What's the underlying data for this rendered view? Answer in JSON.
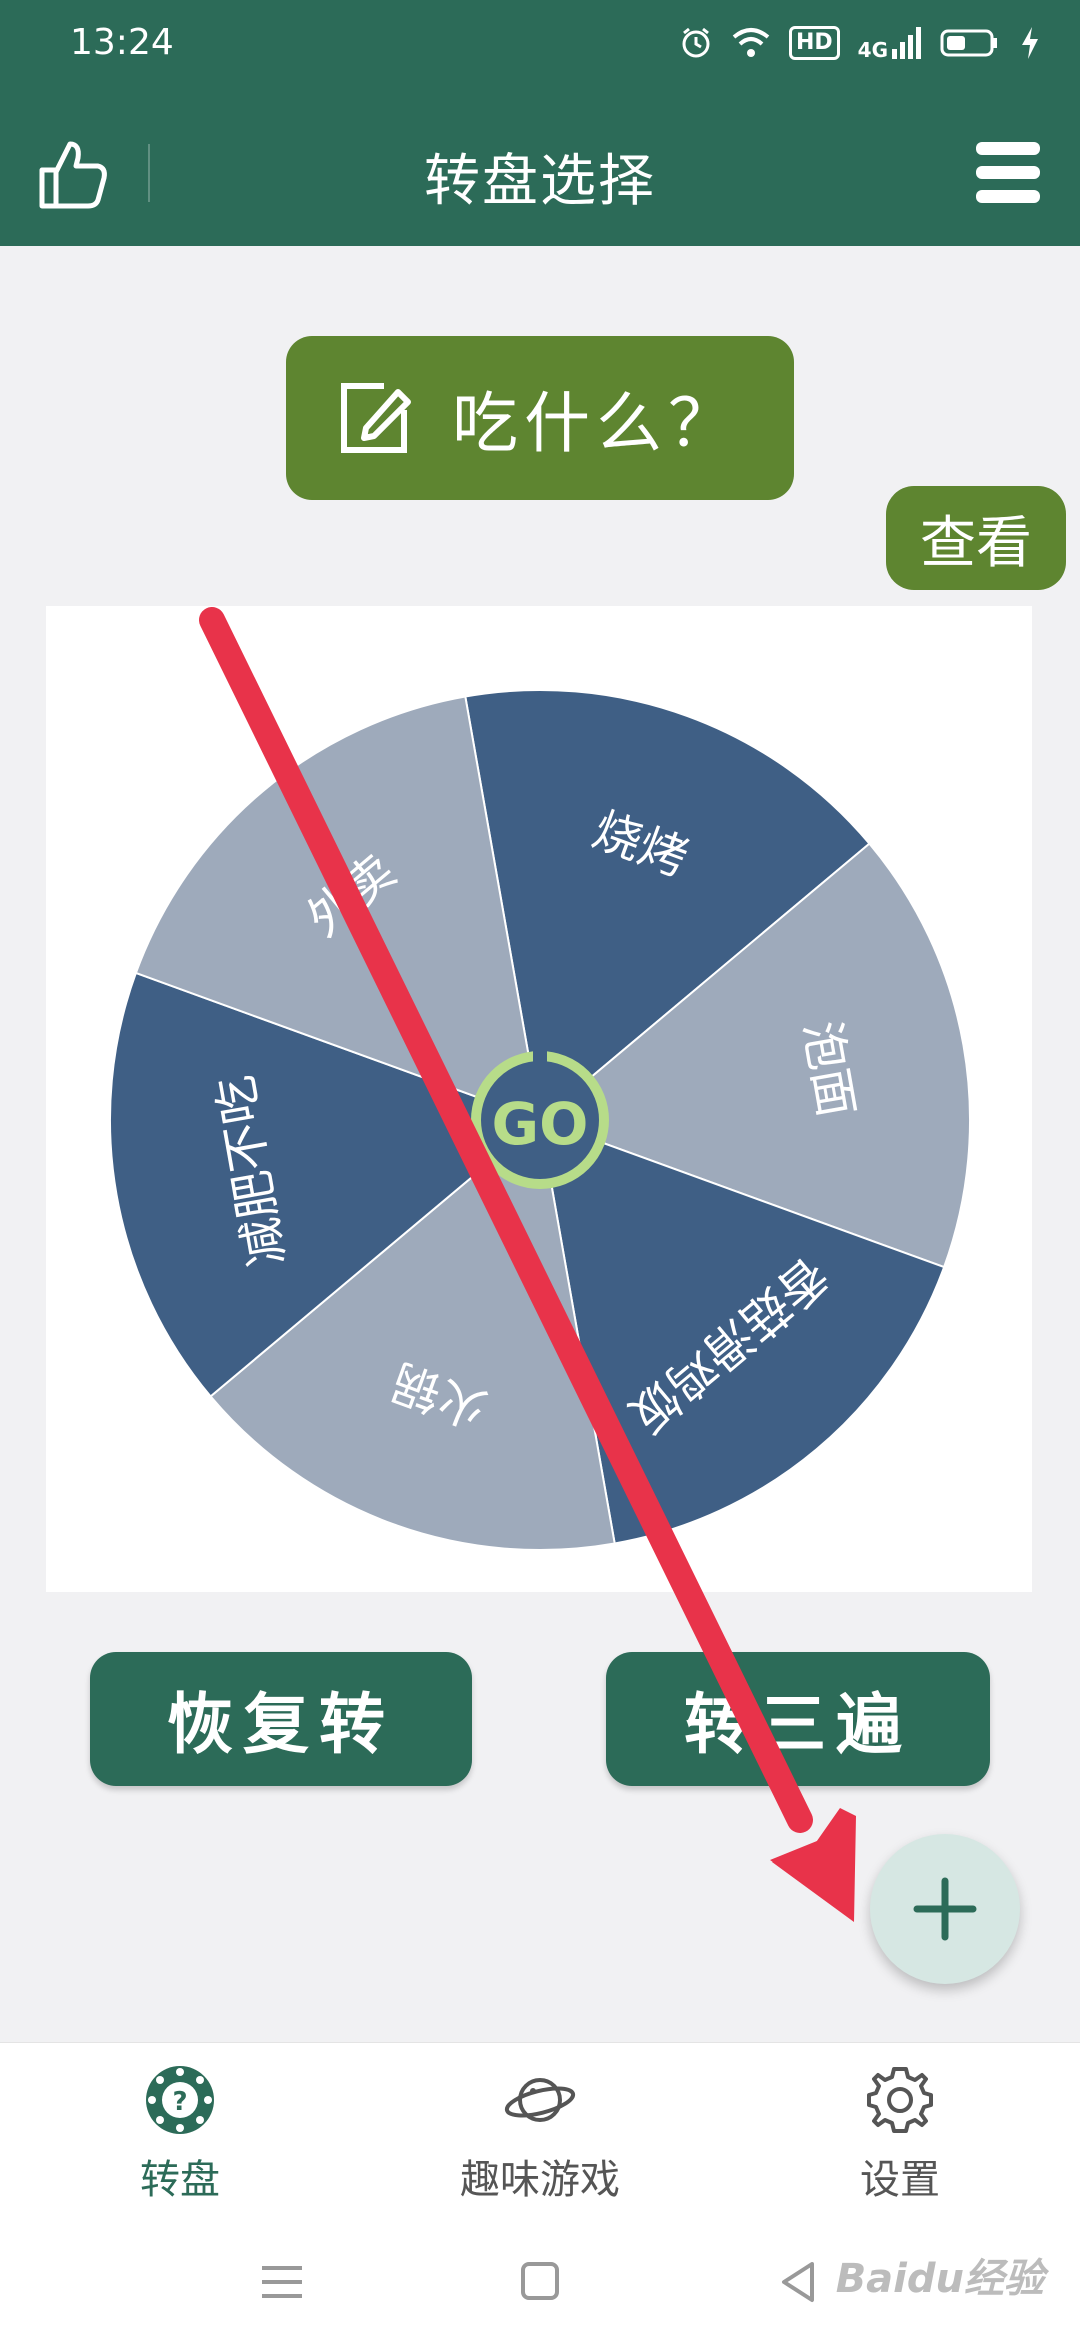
{
  "status_bar": {
    "time": "13:24",
    "hd": "HD",
    "network": "4G"
  },
  "app_bar": {
    "title": "转盘选择"
  },
  "wheel_title": {
    "label": "吃什么？"
  },
  "view_button": {
    "label": "查看"
  },
  "wheel": {
    "go_label": "GO",
    "segments": [
      {
        "label": "烧烤"
      },
      {
        "label": "泡面"
      },
      {
        "label": "香菇滑鸡饭"
      },
      {
        "label": "火锅"
      },
      {
        "label": "减肥不吃"
      },
      {
        "label": "外卖"
      }
    ],
    "colors": {
      "dark": "#3f5f85",
      "light": "#9eaabb"
    }
  },
  "actions": {
    "restore_label": "恢复转",
    "three_times_label": "转三遍"
  },
  "bottom_nav": {
    "items": [
      {
        "label": "转盘"
      },
      {
        "label": "趣味游戏"
      },
      {
        "label": "设置"
      }
    ]
  },
  "watermark": {
    "text": "Baidu经验"
  },
  "colors": {
    "primary": "#2c6b58",
    "accent": "#5e8530",
    "annotation_arrow": "#e8334a"
  }
}
